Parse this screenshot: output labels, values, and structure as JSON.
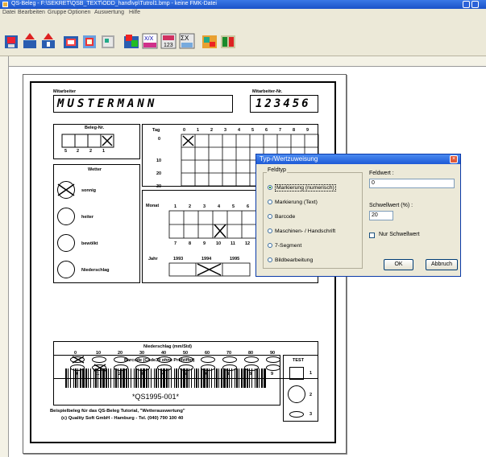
{
  "window": {
    "title": "QS-Beleg - F:\\SEKRET\\QSB_TEXT\\ODD_hand\\vp\\Tutrol1.bmp - keine FMK-Datei"
  },
  "menu": [
    "Datei",
    "Bearbeiten",
    "Gruppe",
    "Optionen",
    "Auswertung",
    "Hilfe"
  ],
  "toolbar": {
    "buttons": [
      "open",
      "new-field",
      "save",
      "tool-4",
      "tool-5",
      "tool-6",
      "tool-7",
      "tool-8",
      "tool-9",
      "tool-10",
      "tool-11",
      "tool-12"
    ]
  },
  "form": {
    "mitarbeiter_label": "Mitarbeiter",
    "mitarbeiter_value": "MUSTERMANN",
    "nr_label": "Mitarbeiter-Nr.",
    "nr_value": "123456",
    "beleg_label": "Beleg-Nr.",
    "beleg_digits": [
      "5",
      "2",
      "2",
      "1"
    ],
    "tag_label": "Tag",
    "tag_cols": [
      "0",
      "1",
      "2",
      "3",
      "4",
      "5",
      "6",
      "7",
      "8",
      "9"
    ],
    "tag_rows": [
      "0",
      "10",
      "20",
      "30"
    ],
    "wetter_label": "Wetter",
    "wetter": [
      "sonnig",
      "heiter",
      "bewölkt",
      "Niederschlag"
    ],
    "monat_label": "Monat",
    "monat_top": [
      "1",
      "2",
      "3",
      "4",
      "5",
      "6"
    ],
    "monat_bottom": [
      "7",
      "8",
      "9",
      "10",
      "11",
      "12"
    ],
    "jahr_label": "Jahr",
    "jahr": [
      "1993",
      "1994",
      "1995"
    ],
    "nied_label": "Niederschlag (mm/Std)",
    "nied_top": [
      "0",
      "10",
      "20",
      "30",
      "40",
      "50",
      "60",
      "70",
      "80",
      "90"
    ],
    "nied_bottom": [
      "0",
      "1",
      "2",
      "3",
      "4",
      "5",
      "6",
      "7",
      "8",
      "9"
    ],
    "barcode_label": "Barcode (Code39 ohne Prüfziffer)",
    "barcode_text": "*QS1995-001*",
    "test_label": "TEST",
    "test_nums": [
      "1",
      "2",
      "3"
    ],
    "footer1": "Beispielbeleg für das QS-Beleg Tutorial, \"Wetterauswertung\"",
    "footer2": "(c)   Quality Soft GmbH - Hamburg - Tel. (040) 790 100 40"
  },
  "dialog": {
    "title": "Typ-/Wertzuweisung",
    "feldtyp_label": "Feldtyp",
    "options": [
      "Markierung (numerisch)",
      "Markierung (Text)",
      "Barcode",
      "Maschinen- / Handschrift",
      "7-Segment",
      "Bildbearbeitung"
    ],
    "selected": 0,
    "feldwert_label": "Feldwert :",
    "feldwert_value": "0",
    "schwellwert_label": "Schwellwert (%) :",
    "schwellwert_value": "20",
    "nur_schwellwert_label": "Nur Schwellwert",
    "ok_label": "OK",
    "cancel_label": "Abbruch"
  }
}
